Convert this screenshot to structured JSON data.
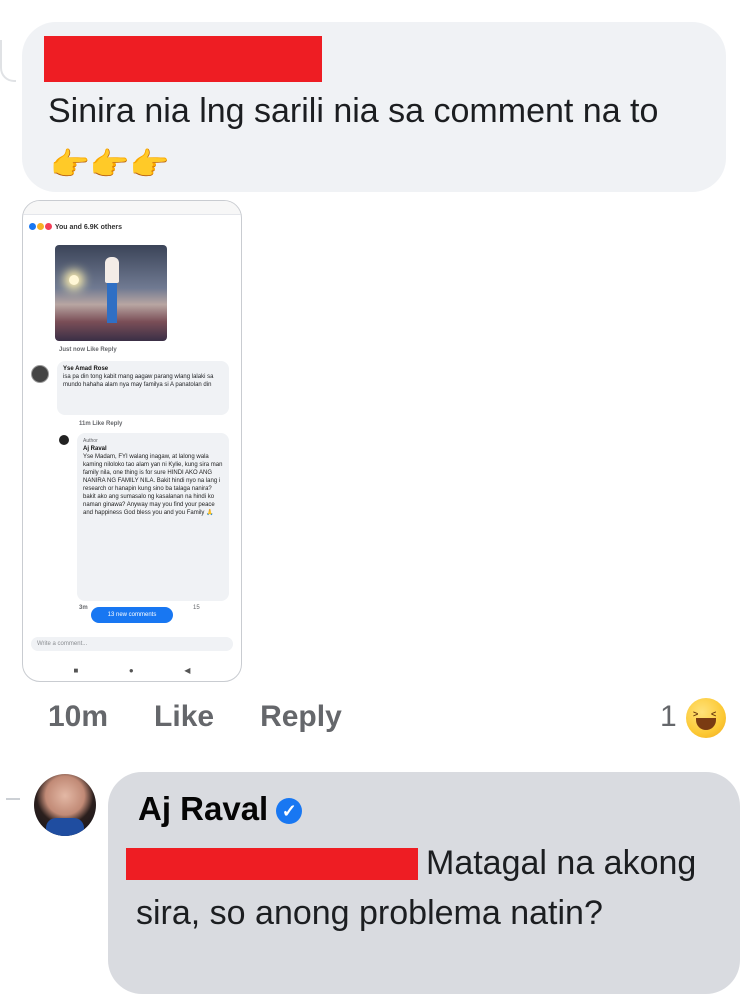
{
  "comment1": {
    "text": "Sinira nia lng sarili nia sa comment na to",
    "emoji": "👉👉👉"
  },
  "screenshot": {
    "reactions_text": "You and 6.9K others",
    "photo_meta": "Just now   Like   Reply",
    "comment_a": {
      "name": "Yse Amad Rose",
      "text": "isa pa din tong kabit mang aagaw parang wlang lalaki sa mundo hahaha alam nya may familya si A panatolan din",
      "meta": "11m   Like   Reply"
    },
    "comment_b": {
      "author_tag": "Author",
      "name": "Aj Raval",
      "text": "Yse Madam, FYI walang inagaw, at lalong wala kaming niloloko tao alam yan ni Kylie, kung sira man family nila, one thing is for sure HINDI AKO ANG NANIRA NG FAMILY NILA. Bakit hindi nyo na lang i research or hanapin kung sino ba talaga nanira? bakit ako ang sumasalo ng kasalanan na hindi ko naman ginawa? Anyway may you find your peace and happiness God bless you and you Family 🙏",
      "meta": "3m",
      "count": "15"
    },
    "new_comments_label": "13 new comments",
    "write_placeholder": "Write a comment...",
    "nav": [
      "■",
      "●",
      "◀"
    ]
  },
  "comment1_actions": {
    "time": "10m",
    "like": "Like",
    "reply": "Reply",
    "reaction_count": "1"
  },
  "comment2": {
    "name": "Aj Raval",
    "verified_icon": "✓",
    "text": "Matagal na akong sira, so anong problema natin?"
  },
  "colors": {
    "bubble": "#f0f2f5",
    "reply_bubble": "#d9dbe0",
    "redaction": "#ee1d23",
    "link_blue": "#1877f2"
  }
}
